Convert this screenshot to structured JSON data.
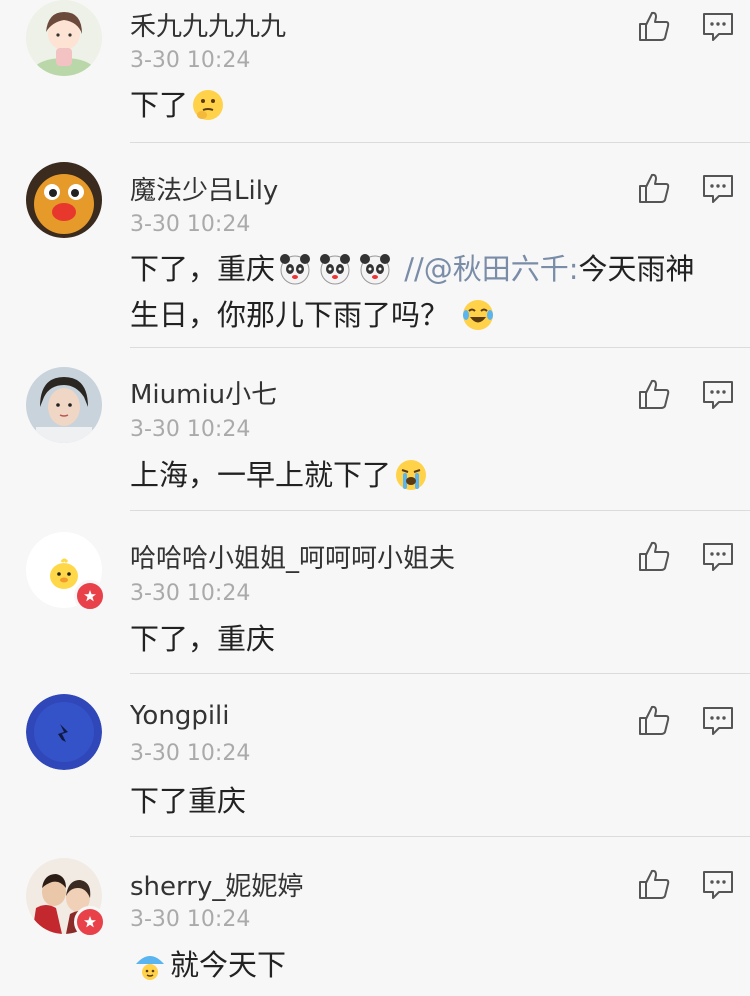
{
  "comments": [
    {
      "username": "禾九九九九九",
      "time": "3-30 10:24",
      "text": "下了",
      "emoji": "thinking-emoji",
      "avatar_icon": "girl-cartoon-avatar"
    },
    {
      "username": "魔法少吕Lily",
      "time": "3-30 10:24",
      "text": "下了，重庆",
      "emojis": [
        "panda-emoji",
        "panda-emoji",
        "panda-emoji"
      ],
      "mention": "//@秋田六千:",
      "quote": "今天雨神生日，你那儿下雨了吗？",
      "trailing_emoji": "laughing-tears-emoji",
      "avatar_icon": "cartoon-duck-avatar"
    },
    {
      "username": "Miumiu小七",
      "time": "3-30 10:24",
      "text": "上海，一早上就下了",
      "emoji": "crying-emoji",
      "avatar_icon": "girl-photo-avatar"
    },
    {
      "username": "哈哈哈小姐姐_呵呵呵小姐夫",
      "time": "3-30 10:24",
      "text": "下了，重庆",
      "avatar_icon": "yellow-duck-avatar",
      "badge_icon": "verified-star-icon"
    },
    {
      "username": "Yongpili",
      "time": "3-30 10:24",
      "text": "下了重庆",
      "avatar_icon": "blue-bird-avatar"
    },
    {
      "username": "sherry_妮妮婷",
      "time": "3-30 10:24",
      "text": "就今天下",
      "leading_emoji": "rain-umbrella-emoji",
      "avatar_icon": "couple-photo-avatar",
      "badge_icon": "verified-star-icon"
    }
  ],
  "actions": {
    "like_icon": "thumbs-up-icon",
    "reply_icon": "comment-bubble-icon"
  },
  "colors": {
    "background": "#f7f7f7",
    "username": "#333333",
    "time": "#aaaaaa",
    "mention": "#7a8da8",
    "badge": "#e8414a"
  }
}
